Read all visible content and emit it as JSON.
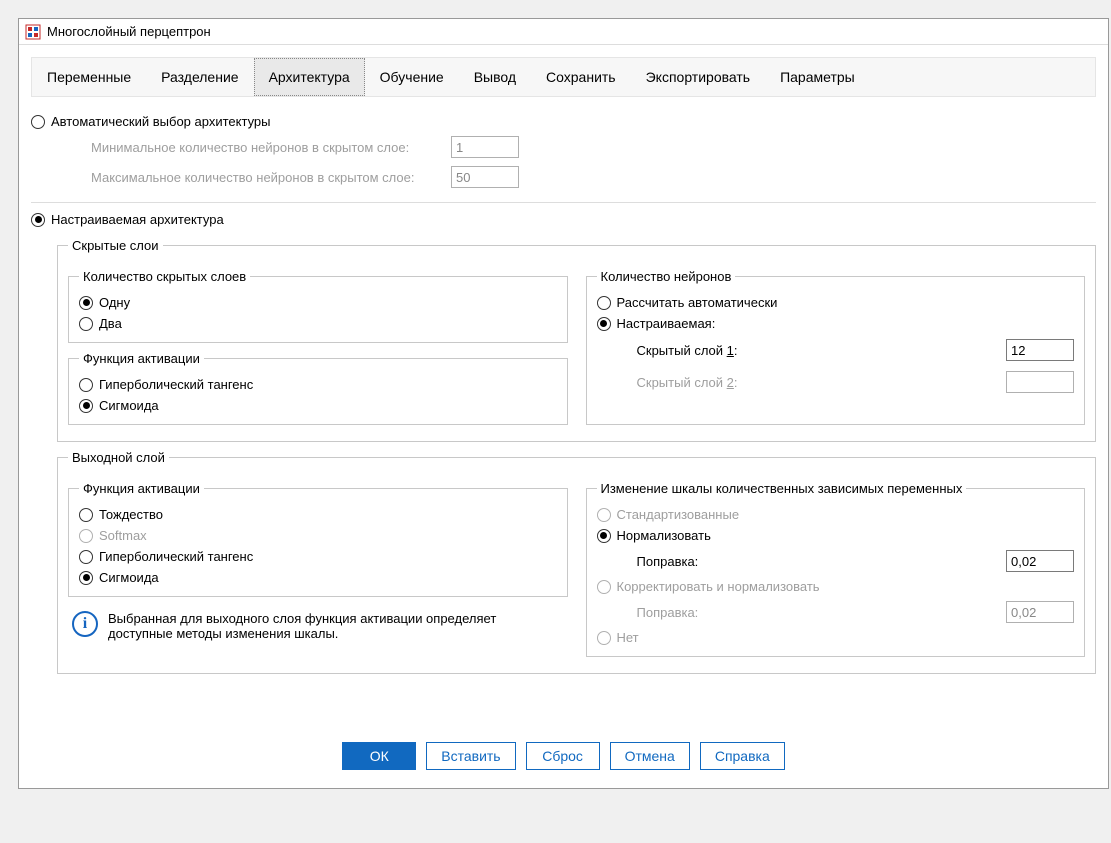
{
  "window": {
    "title": "Многослойный перцептрон"
  },
  "tabs": {
    "items": [
      "Переменные",
      "Разделение",
      "Архитектура",
      "Обучение",
      "Вывод",
      "Сохранить",
      "Экспортировать",
      "Параметры"
    ],
    "selected_index": 2
  },
  "arch": {
    "mode_auto": {
      "label": "Автоматический выбор архитектуры",
      "selected": false,
      "min_label": "Минимальное количество нейронов в скрытом слое:",
      "min_value": "1",
      "max_label": "Максимальное количество нейронов в скрытом слое:",
      "max_value": "50"
    },
    "mode_custom": {
      "label": "Настраиваемая архитектура",
      "selected": true
    },
    "hidden_group": "Скрытые слои",
    "hidden_count": {
      "legend": "Количество скрытых слоев",
      "one": {
        "label": "Одну",
        "selected": true
      },
      "two": {
        "label": "Два",
        "selected": false
      }
    },
    "hidden_activation": {
      "legend": "Функция активации",
      "tanh": {
        "label": "Гиперболический тангенс",
        "selected": false
      },
      "sigmoid": {
        "label": "Сигмоида",
        "selected": true
      }
    },
    "neurons": {
      "legend": "Количество нейронов",
      "auto": {
        "label": "Рассчитать автоматически",
        "selected": false
      },
      "custom": {
        "label": "Настраиваемая:",
        "selected": true
      },
      "layer1_label_pre": "Скрытый слой ",
      "layer1_label_u": "1",
      "layer1_label_post": ":",
      "layer1_value": "12",
      "layer2_label_pre": "Скрытый слой ",
      "layer2_label_u": "2",
      "layer2_label_post": ":",
      "layer2_value": ""
    },
    "output_group": "Выходной слой",
    "output_activation": {
      "legend": "Функция активации",
      "identity": {
        "label": "Тождество",
        "selected": false
      },
      "softmax": {
        "label": "Softmax",
        "selected": false,
        "disabled": true
      },
      "tanh": {
        "label": "Гиперболический тангенс",
        "selected": false
      },
      "sigmoid": {
        "label": "Сигмоида",
        "selected": true
      }
    },
    "info_text": "Выбранная для выходного слоя функция активации определяет доступные методы изменения шкалы.",
    "scale": {
      "legend": "Изменение шкалы количественных зависимых переменных",
      "std": {
        "label": "Стандартизованные",
        "selected": false,
        "disabled": true
      },
      "norm": {
        "label": "Нормализовать",
        "selected": true
      },
      "norm_corr_label": "Поправка:",
      "norm_corr_value": "0,02",
      "adjnorm": {
        "label": "Корректировать и нормализовать",
        "selected": false,
        "disabled": true
      },
      "adjnorm_corr_label": "Поправка:",
      "adjnorm_corr_value": "0,02",
      "none": {
        "label": "Нет",
        "selected": false,
        "disabled": true
      }
    }
  },
  "buttons": {
    "ok": "ОК",
    "paste": "Вставить",
    "reset": "Сброс",
    "cancel": "Отмена",
    "help": "Справка"
  }
}
